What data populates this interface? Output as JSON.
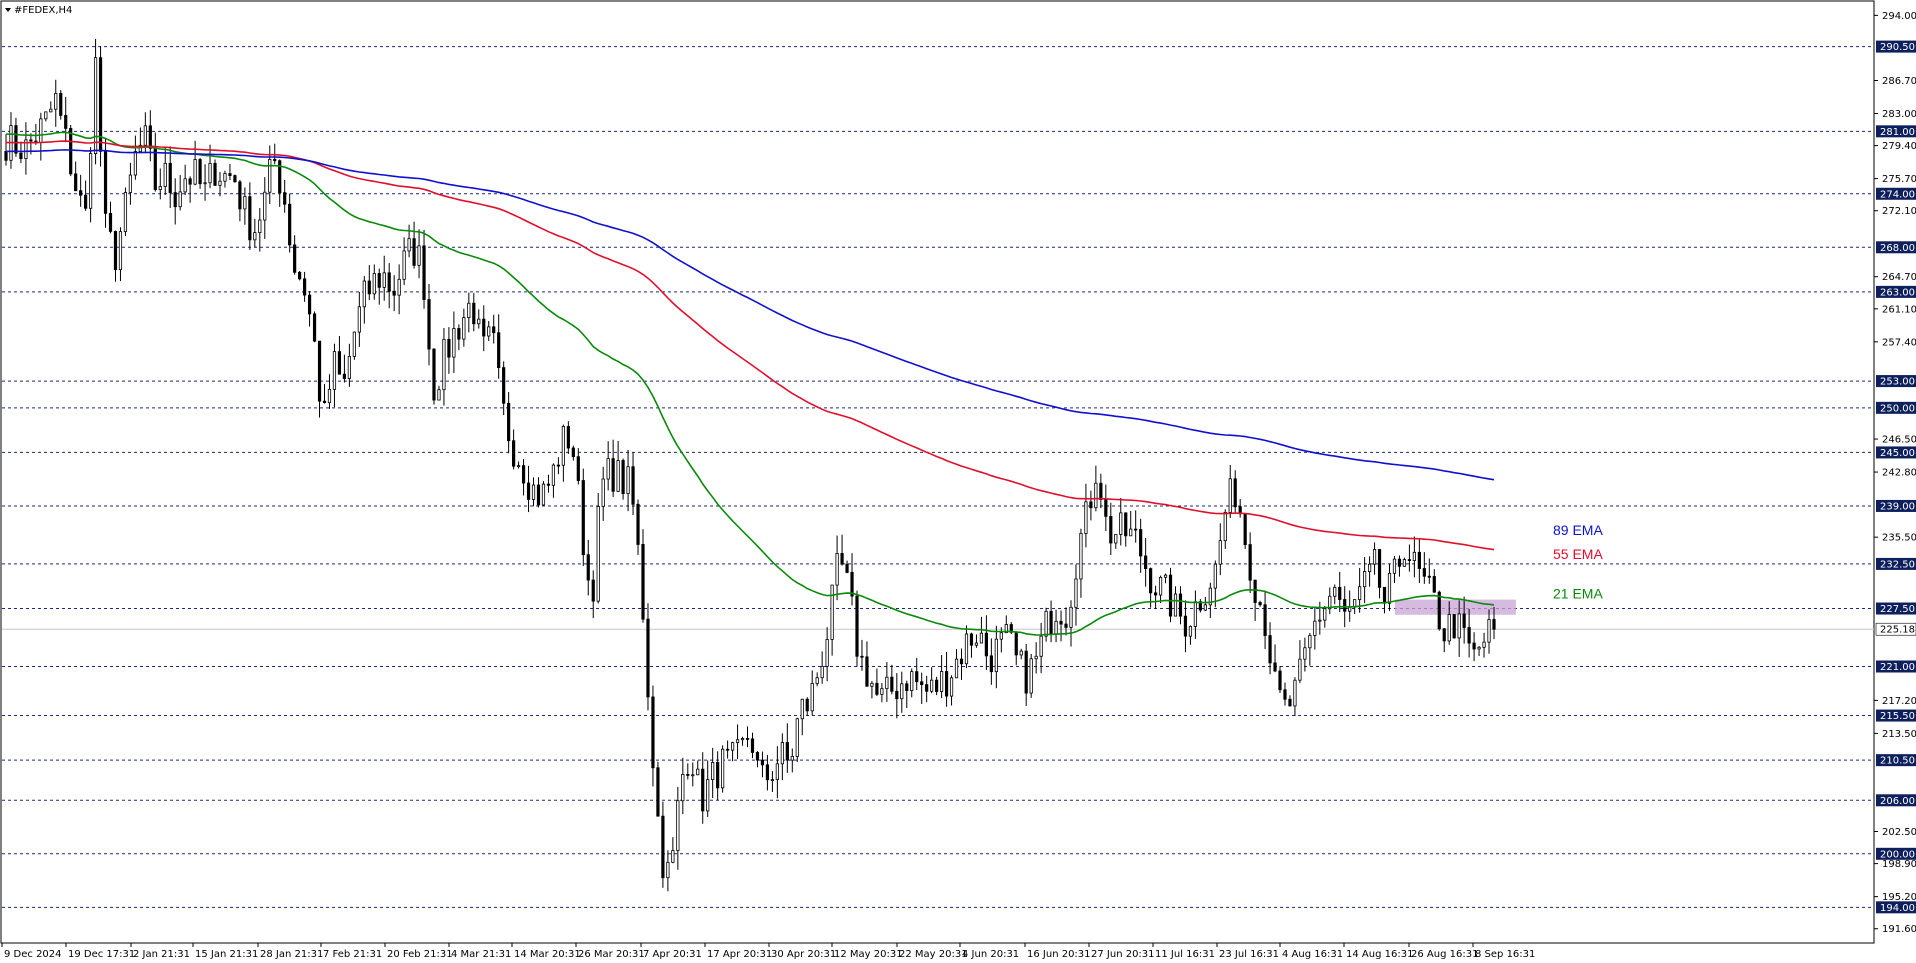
{
  "window": {
    "symbol_label": "#FEDEX,H4"
  },
  "colors": {
    "ema21": "#0a8a0a",
    "ema55": "#e0102c",
    "ema89": "#1010d0",
    "level_line": "#1a2a7a",
    "level_label_bg": "#0d1f5c",
    "zone": "#c9a3d6",
    "candle": "#000000"
  },
  "chart_data": {
    "type": "candlestick",
    "symbol": "#FEDEX,H4",
    "ylim": [
      190.0,
      295.5
    ],
    "y_ticks": [
      {
        "value": 294.0,
        "label": "294.00"
      },
      {
        "value": 286.7,
        "label": "286.70"
      },
      {
        "value": 283.0,
        "label": "283.00"
      },
      {
        "value": 279.4,
        "label": "279.40"
      },
      {
        "value": 275.7,
        "label": "275.70"
      },
      {
        "value": 272.1,
        "label": "272.10"
      },
      {
        "value": 264.7,
        "label": "264.70"
      },
      {
        "value": 261.1,
        "label": "261.10"
      },
      {
        "value": 257.4,
        "label": "257.40"
      },
      {
        "value": 246.5,
        "label": "246.50"
      },
      {
        "value": 242.8,
        "label": "242.80"
      },
      {
        "value": 235.5,
        "label": "235.50"
      },
      {
        "value": 217.2,
        "label": "217.20"
      },
      {
        "value": 213.5,
        "label": "213.50"
      },
      {
        "value": 202.5,
        "label": "202.50"
      },
      {
        "value": 198.9,
        "label": "198.90"
      },
      {
        "value": 195.2,
        "label": "195.20"
      },
      {
        "value": 191.6,
        "label": "191.60"
      }
    ],
    "levels": [
      {
        "value": 290.5,
        "label": "290.50"
      },
      {
        "value": 281.0,
        "label": "281.00"
      },
      {
        "value": 274.0,
        "label": "274.00"
      },
      {
        "value": 268.0,
        "label": "268.00"
      },
      {
        "value": 263.0,
        "label": "263.00"
      },
      {
        "value": 253.0,
        "label": "253.00"
      },
      {
        "value": 250.0,
        "label": "250.00"
      },
      {
        "value": 245.0,
        "label": "245.00"
      },
      {
        "value": 239.0,
        "label": "239.00"
      },
      {
        "value": 232.5,
        "label": "232.50"
      },
      {
        "value": 227.5,
        "label": "227.50"
      },
      {
        "value": 221.0,
        "label": "221.00"
      },
      {
        "value": 215.5,
        "label": "215.50"
      },
      {
        "value": 210.5,
        "label": "210.50"
      },
      {
        "value": 206.0,
        "label": "206.00"
      },
      {
        "value": 200.0,
        "label": "200.00"
      },
      {
        "value": 194.0,
        "label": "194.00"
      }
    ],
    "current_price": {
      "value": 225.18,
      "label": "225.18"
    },
    "x_ticks": [
      "9 Dec 2024",
      "19 Dec 17:31",
      "2 Jan 21:31",
      "15 Jan 21:31",
      "28 Jan 21:31",
      "7 Feb 21:31",
      "20 Feb 21:31",
      "4 Mar 21:31",
      "14 Mar 20:31",
      "26 Mar 20:31",
      "7 Apr 20:31",
      "17 Apr 20:31",
      "30 Apr 20:31",
      "12 May 20:31",
      "22 May 20:31",
      "4 Jun 20:31",
      "16 Jun 20:31",
      "27 Jun 20:31",
      "11 Jul 16:31",
      "23 Jul 16:31",
      "4 Aug 16:31",
      "14 Aug 16:31",
      "26 Aug 16:31",
      "8 Sep 16:31"
    ],
    "price_path": [
      [
        0,
        280
      ],
      [
        2,
        279
      ],
      [
        4,
        282
      ],
      [
        5,
        284.5
      ],
      [
        6,
        280
      ],
      [
        7,
        275
      ],
      [
        8,
        271
      ],
      [
        9,
        289
      ],
      [
        10,
        270
      ],
      [
        11,
        267
      ],
      [
        12,
        272
      ],
      [
        13,
        278
      ],
      [
        14,
        280
      ],
      [
        15,
        275
      ],
      [
        16,
        276
      ],
      [
        17,
        274
      ],
      [
        18,
        276
      ],
      [
        19,
        276
      ],
      [
        20,
        274
      ],
      [
        21,
        277
      ],
      [
        22,
        276
      ],
      [
        23,
        276
      ],
      [
        24,
        272
      ],
      [
        25,
        270
      ],
      [
        26,
        273
      ],
      [
        27,
        278
      ],
      [
        28,
        274
      ],
      [
        29,
        266
      ],
      [
        30,
        264
      ],
      [
        31,
        258
      ],
      [
        32,
        248
      ],
      [
        33,
        255
      ],
      [
        34,
        252
      ],
      [
        35,
        258
      ],
      [
        36,
        262
      ],
      [
        37,
        264
      ],
      [
        38,
        265
      ],
      [
        39,
        263
      ],
      [
        40,
        266
      ],
      [
        41,
        268
      ],
      [
        42,
        266
      ],
      [
        43,
        252
      ],
      [
        44,
        255
      ],
      [
        45,
        258
      ],
      [
        46,
        260
      ],
      [
        47,
        262
      ],
      [
        48,
        256
      ],
      [
        49,
        258
      ],
      [
        50,
        250
      ],
      [
        51,
        246
      ],
      [
        52,
        244
      ],
      [
        53,
        241
      ],
      [
        54,
        240
      ],
      [
        55,
        242
      ],
      [
        56,
        246
      ],
      [
        57,
        247
      ],
      [
        58,
        237
      ],
      [
        59,
        228
      ],
      [
        60,
        241
      ],
      [
        61,
        243
      ],
      [
        62,
        242
      ],
      [
        63,
        241
      ],
      [
        64,
        231
      ],
      [
        65,
        214
      ],
      [
        66,
        200
      ],
      [
        67,
        197
      ],
      [
        68,
        208
      ],
      [
        69,
        212
      ],
      [
        70,
        206
      ],
      [
        71,
        208
      ],
      [
        72,
        210
      ],
      [
        73,
        210
      ],
      [
        74,
        211
      ],
      [
        75,
        214
      ],
      [
        76,
        208
      ],
      [
        77,
        209
      ],
      [
        78,
        211
      ],
      [
        79,
        210
      ],
      [
        80,
        216
      ],
      [
        81,
        217
      ],
      [
        82,
        221
      ],
      [
        83,
        226
      ],
      [
        84,
        233
      ],
      [
        85,
        229
      ],
      [
        86,
        222
      ],
      [
        87,
        220
      ],
      [
        88,
        217
      ],
      [
        89,
        218
      ],
      [
        90,
        219
      ],
      [
        91,
        220
      ],
      [
        92,
        219
      ],
      [
        93,
        218
      ],
      [
        94,
        219
      ],
      [
        95,
        220
      ],
      [
        96,
        222
      ],
      [
        97,
        224
      ],
      [
        98,
        225
      ],
      [
        99,
        222
      ],
      [
        100,
        223
      ],
      [
        101,
        224
      ],
      [
        102,
        221
      ],
      [
        103,
        220
      ],
      [
        104,
        222
      ],
      [
        105,
        226
      ],
      [
        106,
        228
      ],
      [
        107,
        227
      ],
      [
        108,
        234
      ],
      [
        109,
        238
      ],
      [
        110,
        244
      ],
      [
        111,
        236
      ],
      [
        112,
        236
      ],
      [
        113,
        236
      ],
      [
        114,
        235
      ],
      [
        115,
        232
      ],
      [
        116,
        230
      ],
      [
        117,
        229
      ],
      [
        118,
        227
      ],
      [
        119,
        226
      ],
      [
        120,
        228
      ],
      [
        121,
        230
      ],
      [
        122,
        232
      ],
      [
        123,
        239
      ],
      [
        124,
        241
      ],
      [
        125,
        235
      ],
      [
        126,
        230
      ],
      [
        127,
        226
      ],
      [
        128,
        218
      ],
      [
        129,
        216
      ],
      [
        130,
        218
      ],
      [
        131,
        222
      ],
      [
        132,
        226
      ],
      [
        133,
        228
      ],
      [
        134,
        230
      ],
      [
        135,
        226
      ],
      [
        136,
        228
      ],
      [
        137,
        230
      ],
      [
        138,
        232
      ],
      [
        139,
        228
      ],
      [
        140,
        231
      ],
      [
        141,
        235
      ],
      [
        142,
        232
      ],
      [
        143,
        230
      ],
      [
        144,
        228
      ],
      [
        145,
        225
      ],
      [
        146,
        226
      ],
      [
        147,
        224
      ],
      [
        148,
        222
      ],
      [
        149,
        224
      ],
      [
        150,
        225.2
      ]
    ],
    "series": [
      {
        "name": "21 EMA",
        "period": 21
      },
      {
        "name": "55 EMA",
        "period": 55
      },
      {
        "name": "89 EMA",
        "period": 89
      }
    ],
    "annotations": [
      {
        "text": "89 EMA",
        "value": 236.3
      },
      {
        "text": "55 EMA",
        "value": 233.6
      },
      {
        "text": "21 EMA",
        "value": 229.2
      }
    ],
    "zone": {
      "from": 226.8,
      "to": 228.5,
      "start_index": 140,
      "end_index": 151
    }
  }
}
